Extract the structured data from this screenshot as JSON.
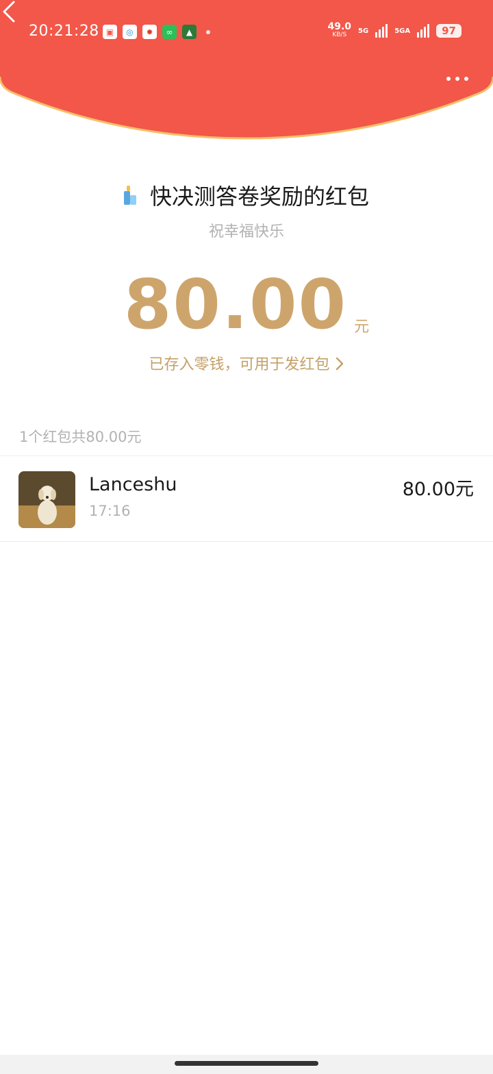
{
  "status_bar": {
    "time": "20:21:28",
    "net_speed": "49.0",
    "net_speed_unit": "KB/S",
    "net_type_1": "5G",
    "net_type_2": "5GA",
    "battery": "97"
  },
  "header": {
    "back_icon": "chevron-left-icon",
    "more_icon": "more-dots-icon",
    "color": "#f25749"
  },
  "packet": {
    "title": "快决测答卷奖励的红包",
    "blessing": "祝幸福快乐",
    "amount": "80.00",
    "unit": "元",
    "saved_link": "已存入零钱，可用于发红包"
  },
  "summary": "1个红包共80.00元",
  "records": [
    {
      "name": "Lanceshu",
      "time": "17:16",
      "amount": "80.00元"
    }
  ],
  "colors": {
    "gold": "#cda56c",
    "red": "#f25749"
  }
}
